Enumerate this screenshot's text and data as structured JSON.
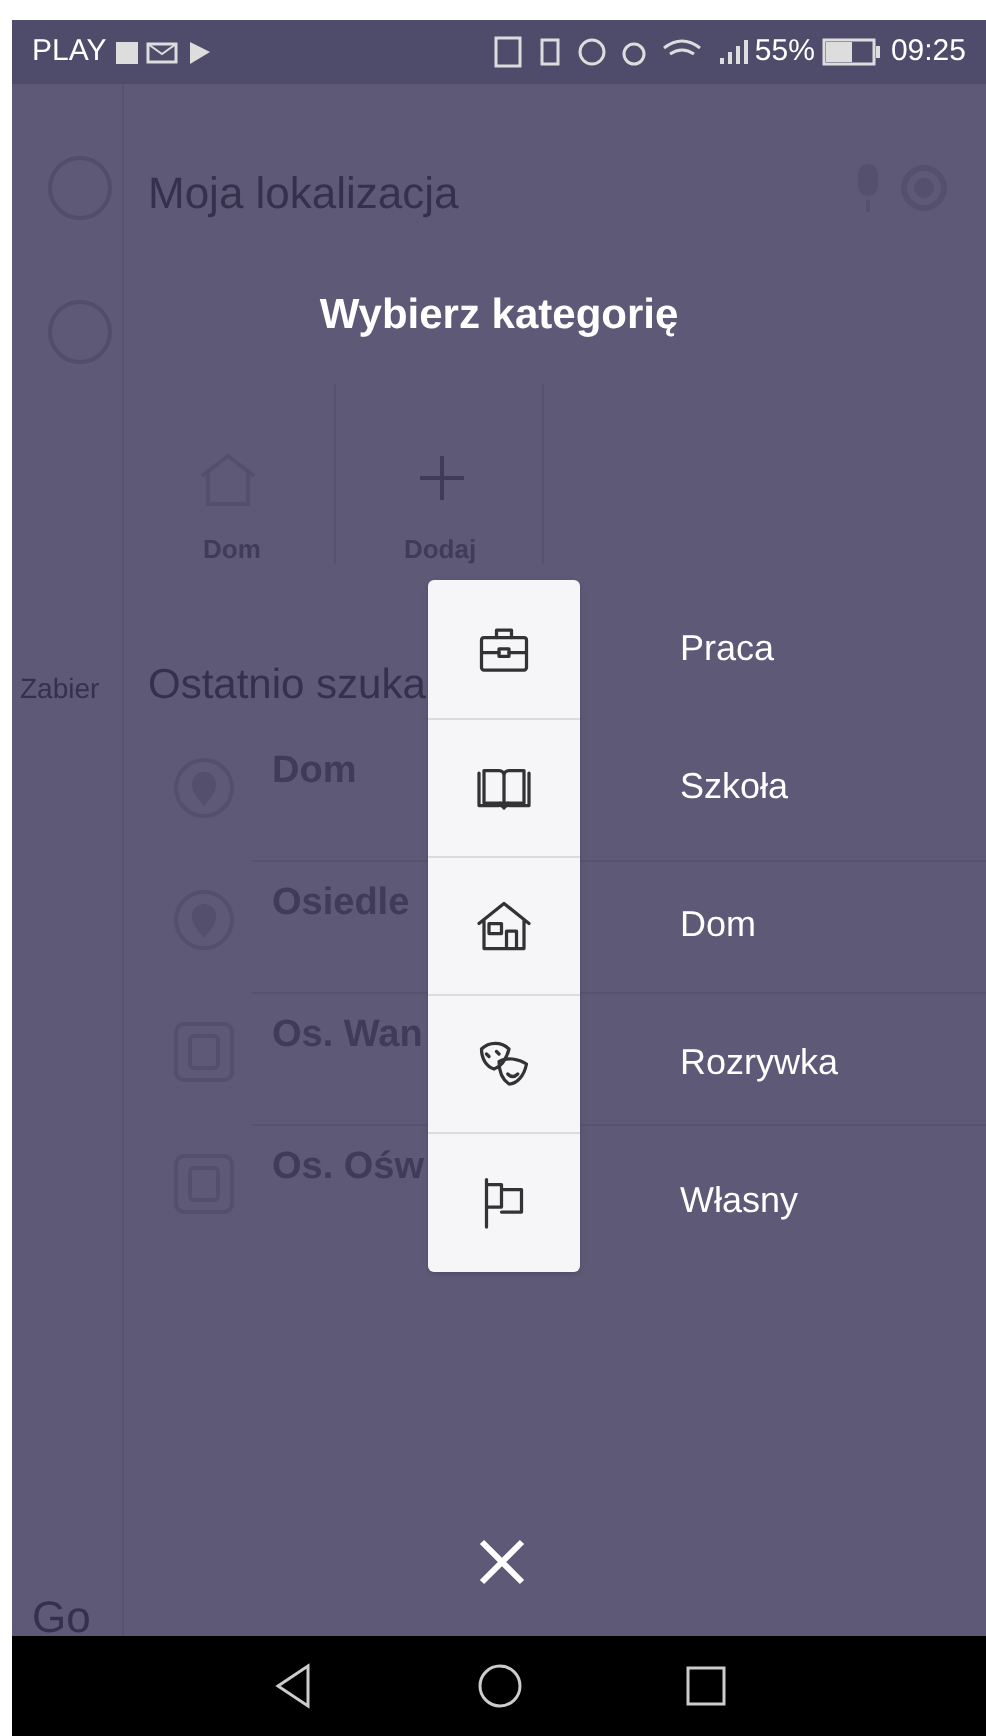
{
  "status_bar": {
    "carrier": "PLAY",
    "battery": "55%",
    "time": "09:25"
  },
  "background": {
    "search": {
      "placeholder": "Moja lokalizacja"
    },
    "favorites": [
      "Dom",
      "Dodaj"
    ],
    "side_label": "Zabier",
    "recent_title": "Ostatnio szuka",
    "recent": [
      {
        "kind": "place",
        "title": "Dom"
      },
      {
        "kind": "place",
        "title": "Osiedle"
      },
      {
        "kind": "stop",
        "title": "Os. Wan"
      },
      {
        "kind": "stop",
        "title": "Os. Ośw"
      }
    ],
    "logo": "Go"
  },
  "dialog": {
    "title": "Wybierz kategorię",
    "categories": [
      {
        "kind": "work",
        "label": "Praca"
      },
      {
        "kind": "school",
        "label": "Szkoła"
      },
      {
        "kind": "home",
        "label": "Dom"
      },
      {
        "kind": "fun",
        "label": "Rozrywka"
      },
      {
        "kind": "custom",
        "label": "Własny"
      }
    ]
  }
}
